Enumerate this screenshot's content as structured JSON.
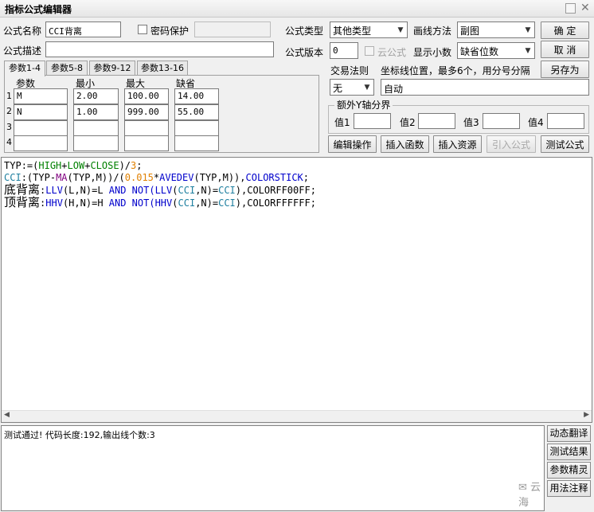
{
  "window": {
    "title": "指标公式编辑器"
  },
  "form": {
    "name_label": "公式名称",
    "name_value": "CCI背离",
    "password_label": "密码保护",
    "desc_label": "公式描述",
    "desc_value": "",
    "type_label": "公式类型",
    "type_value": "其他类型",
    "draw_label": "画线方法",
    "draw_value": "副图",
    "version_label": "公式版本",
    "version_value": "0",
    "cloud_label": "云公式",
    "decimals_label": "显示小数",
    "decimals_value": "缺省位数",
    "trade_label": "交易法则",
    "trade_value": "无",
    "coord_label": "坐标线位置，最多6个，用分号分隔",
    "coord_value": "自动",
    "yaxis_group": "额外Y轴分界",
    "val1_label": "值1",
    "val2_label": "值2",
    "val3_label": "值3",
    "val4_label": "值4"
  },
  "buttons": {
    "ok": "确  定",
    "cancel": "取  消",
    "save_as": "另存为",
    "edit_op": "编辑操作",
    "insert_func": "插入函数",
    "insert_res": "插入资源",
    "import_formula": "引入公式",
    "test_formula": "测试公式"
  },
  "tabs": [
    "参数1-4",
    "参数5-8",
    "参数9-12",
    "参数13-16"
  ],
  "params": {
    "headers": [
      "参数",
      "最小",
      "最大",
      "缺省"
    ],
    "rows": [
      {
        "num": "1",
        "name": "M",
        "min": "2.00",
        "max": "100.00",
        "def": "14.00"
      },
      {
        "num": "2",
        "name": "N",
        "min": "1.00",
        "max": "999.00",
        "def": "55.00"
      },
      {
        "num": "3",
        "name": "",
        "min": "",
        "max": "",
        "def": ""
      },
      {
        "num": "4",
        "name": "",
        "min": "",
        "max": "",
        "def": ""
      }
    ]
  },
  "code": {
    "colors": {
      "black": "#000000",
      "blue": "#0000cc",
      "teal": "#2080a0",
      "green": "#008000",
      "orange": "#e08000",
      "purple": "#800080"
    }
  },
  "output": {
    "text": "测试通过! 代码长度:192,输出线个数:3"
  },
  "side_buttons": [
    "动态翻译",
    "测试结果",
    "参数精灵",
    "用法注释"
  ],
  "watermark": "云海"
}
